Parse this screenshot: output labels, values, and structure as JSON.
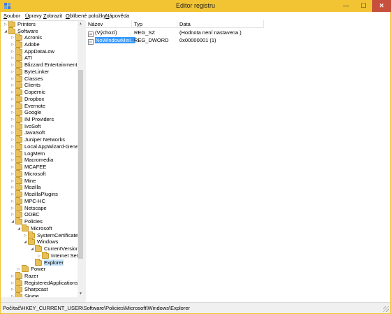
{
  "window": {
    "title": "Editor registru",
    "controls": {
      "minimize": "—",
      "maximize": "☐",
      "close": "✕"
    }
  },
  "menu": {
    "items": [
      {
        "key": "S",
        "rest": "oubor"
      },
      {
        "key": "Ú",
        "rest": "pravy"
      },
      {
        "key": "Z",
        "rest": "obrazit"
      },
      {
        "key": "O",
        "rest": "blíbené položky"
      },
      {
        "key": "N",
        "rest": "ápověda"
      }
    ]
  },
  "tree": {
    "items": [
      {
        "label": "Printers",
        "toggle": "▷"
      },
      {
        "label": "Software",
        "toggle": "◢"
      },
      {
        "label": "Acronis",
        "toggle": "▷"
      },
      {
        "label": "Adobe",
        "toggle": "▷"
      },
      {
        "label": "AppDataLow",
        "toggle": "▷"
      },
      {
        "label": "ATI",
        "toggle": "▷"
      },
      {
        "label": "Blizzard Entertainment",
        "toggle": "▷"
      },
      {
        "label": "ByteLinker",
        "toggle": "▷"
      },
      {
        "label": "Classes",
        "toggle": "▷"
      },
      {
        "label": "Clients",
        "toggle": "▷"
      },
      {
        "label": "Copernic",
        "toggle": "▷"
      },
      {
        "label": "Dropbox",
        "toggle": "▷"
      },
      {
        "label": "Evernote",
        "toggle": "▷"
      },
      {
        "label": "Google",
        "toggle": "▷"
      },
      {
        "label": "IM Providers",
        "toggle": "▷"
      },
      {
        "label": "IvoSoft",
        "toggle": "▷"
      },
      {
        "label": "JavaSoft",
        "toggle": "▷"
      },
      {
        "label": "Juniper Networks",
        "toggle": "▷"
      },
      {
        "label": "Local AppWizard-Generated",
        "toggle": "▷"
      },
      {
        "label": "LogMeIn",
        "toggle": "▷"
      },
      {
        "label": "Macromedia",
        "toggle": "▷"
      },
      {
        "label": "MCAFEE",
        "toggle": "▷"
      },
      {
        "label": "Microsoft",
        "toggle": "▷"
      },
      {
        "label": "Mine",
        "toggle": "▷"
      },
      {
        "label": "Mozilla",
        "toggle": "▷"
      },
      {
        "label": "MozillaPlugins",
        "toggle": "▷"
      },
      {
        "label": "MPC-HC",
        "toggle": "▷"
      },
      {
        "label": "Netscape",
        "toggle": "▷"
      },
      {
        "label": "ODBC",
        "toggle": "▷"
      },
      {
        "label": "Policies",
        "toggle": "◢"
      },
      {
        "label": "Microsoft",
        "toggle": "◢"
      },
      {
        "label": "SystemCertificates",
        "toggle": "▷"
      },
      {
        "label": "Windows",
        "toggle": "◢"
      },
      {
        "label": "CurrentVersion",
        "toggle": "◢"
      },
      {
        "label": "Internet Setti",
        "toggle": "▷"
      },
      {
        "label": "Explorer",
        "toggle": ""
      },
      {
        "label": "Power",
        "toggle": "▷"
      },
      {
        "label": "Razer",
        "toggle": "▷"
      },
      {
        "label": "RegisteredApplications",
        "toggle": "▷"
      },
      {
        "label": "Sharpcast",
        "toggle": "▷"
      },
      {
        "label": "Skype",
        "toggle": "▷"
      }
    ],
    "scroll": {
      "up": "▲",
      "down": "▼"
    }
  },
  "list": {
    "columns": {
      "name": "Název",
      "type": "Typ",
      "data": "Data"
    },
    "rows": [
      {
        "name": "(Výchozí)",
        "type": "REG_SZ",
        "data": "(Hodnota není nastavena.)",
        "icon": "ab"
      },
      {
        "name": "NoWindowMini...",
        "type": "REG_DWORD",
        "data": "0x00000001 (1)",
        "icon": "01"
      }
    ]
  },
  "status": {
    "path": "Počítač\\HKEY_CURRENT_USER\\Software\\Policies\\Microsoft\\Windows\\Explorer"
  },
  "colors": {
    "titlebar": "#f2c434",
    "close": "#c7503c",
    "selection": "#3399ff",
    "tree_selection": "#cce8ff"
  }
}
